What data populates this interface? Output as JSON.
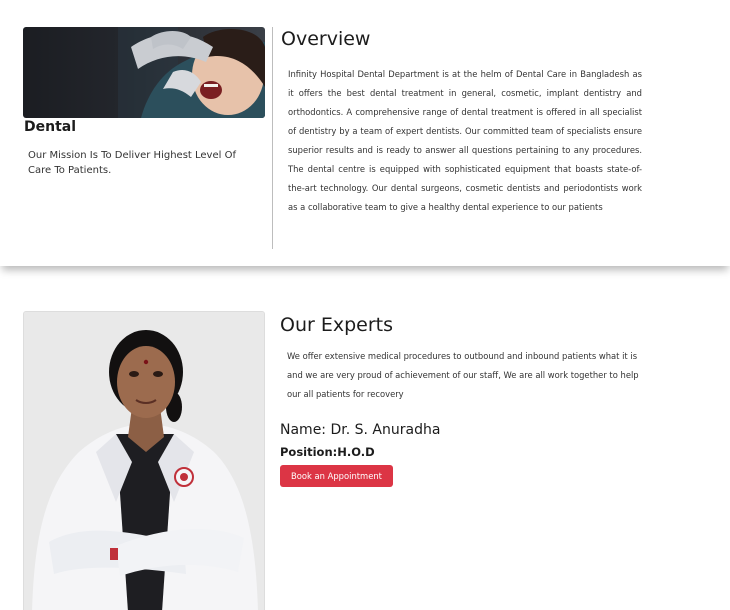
{
  "department": {
    "name": "Dental",
    "mission": "Our Mission Is To Deliver Highest Level Of Care To Patients."
  },
  "overview": {
    "title": "Overview",
    "text": "Infinity Hospital Dental Department is at the helm of Dental Care in Bangladesh as it offers the best dental treatment in general, cosmetic, implant dentistry and orthodontics. A comprehensive range of dental treatment is offered in all specialist of dentistry by a team of expert dentists. Our committed team of specialists ensure superior results and is ready to answer all questions pertaining to any procedures. The dental centre is equipped with sophisticated equipment that boasts state-of-the-art technology. Our dental surgeons, cosmetic dentists and periodontists work as a collaborative team to give a healthy dental experience to our patients"
  },
  "experts": {
    "title": "Our Experts",
    "text": "We offer extensive medical procedures to outbound and inbound patients what it is and we are very proud of achievement of our staff, We are all work together to help our all patients for recovery",
    "name": "Name: Dr. S. Anuradha",
    "position": "Position:H.O.D",
    "button_label": "Book an Appointment"
  },
  "colors": {
    "accent_button": "#dc3545",
    "divider": "#bdbdbd"
  }
}
